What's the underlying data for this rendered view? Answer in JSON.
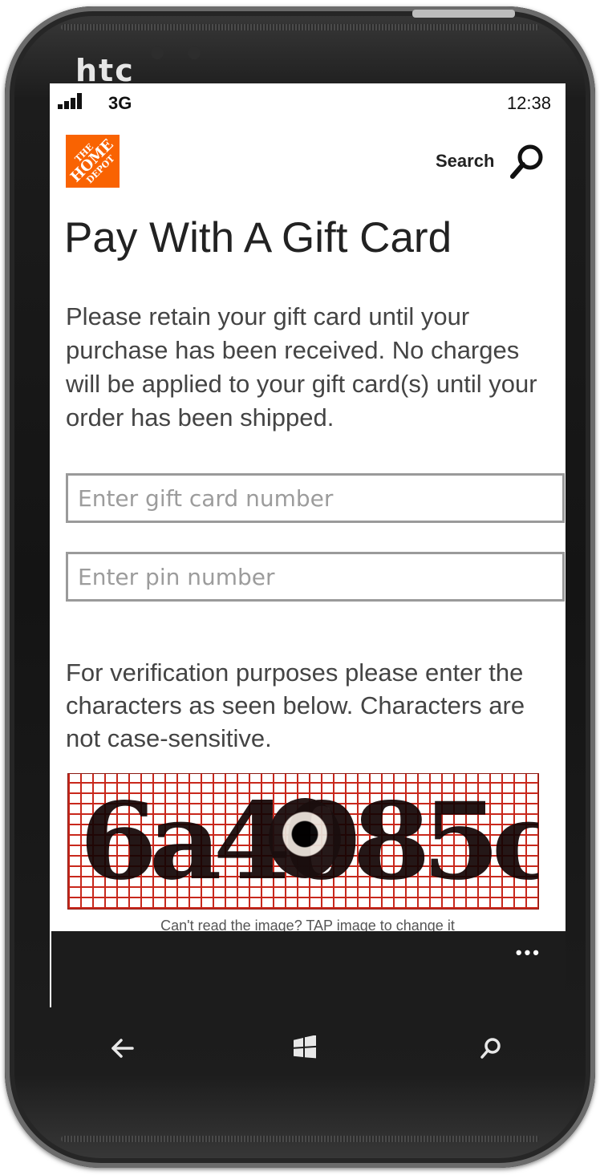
{
  "device": {
    "brand": "htc"
  },
  "status_bar": {
    "network": "3G",
    "time": "12:38"
  },
  "header": {
    "logo_text_top": "THE",
    "logo_text_main": "HOME",
    "logo_text_bottom": "DEPOT",
    "search_label": "Search"
  },
  "page": {
    "title": "Pay With A Gift Card",
    "intro": "Please retain your gift card until your purchase has been received. No charges will be applied to your gift card(s) until your order has been shipped.",
    "gift_card_placeholder": "Enter gift card number",
    "pin_placeholder": "Enter pin number",
    "verify_text": "For verification purposes please enter the characters as seen below. Characters are not case-sensitive.",
    "captcha_text": "6a4085c",
    "captcha_hint": "Can't read the image? TAP image to change it"
  },
  "app_bar": {
    "more_label": "•••"
  },
  "hardware_buttons": {
    "back": "back-arrow-icon",
    "start": "windows-logo-icon",
    "search": "search-icon"
  }
}
